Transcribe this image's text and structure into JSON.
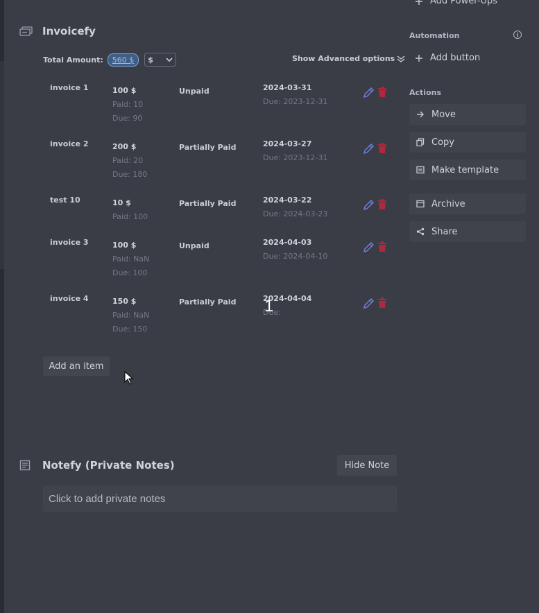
{
  "invoicefy": {
    "title": "Invoicefy",
    "total_label": "Total Amount:",
    "total_value": "560 $",
    "currency": "$",
    "advanced_label": "Show Advanced options",
    "invoices": [
      {
        "name": "invoice 1",
        "amount": "100 $",
        "paid": "Paid: 10",
        "due_amount": "Due: 90",
        "status": "Unpaid",
        "date": "2024-03-31",
        "due_date": "Due: 2023-12-31"
      },
      {
        "name": "invoice 2",
        "amount": "200 $",
        "paid": "Paid: 20",
        "due_amount": "Due: 180",
        "status": "Partially Paid",
        "date": "2024-03-27",
        "due_date": "Due: 2023-12-31"
      },
      {
        "name": "test 10",
        "amount": "10 $",
        "paid": "Paid: 100",
        "due_amount": "",
        "status": "Partially Paid",
        "date": "2024-03-22",
        "due_date": "Due: 2024-03-23"
      },
      {
        "name": "invoice 3",
        "amount": "100 $",
        "paid": "Paid: NaN",
        "due_amount": "Due: 100",
        "status": "Unpaid",
        "date": "2024-04-03",
        "due_date": "Due: 2024-04-10"
      },
      {
        "name": "invoice 4",
        "amount": "150 $",
        "paid": "Paid: NaN",
        "due_amount": "Due: 150",
        "status": "Partially Paid",
        "date": "2024-04-04",
        "due_date": "Due:"
      }
    ],
    "add_item_label": "Add an item"
  },
  "overlay_number": "1",
  "notefy": {
    "title": "Notefy (Private Notes)",
    "hide_label": "Hide Note",
    "placeholder": "Click to add private notes"
  },
  "sidebar": {
    "power_ups_label": "Add Power-Ups",
    "automation_label": "Automation",
    "add_button_label": "Add button",
    "actions_label": "Actions",
    "actions": [
      {
        "label": "Move",
        "icon": "arrow-right-icon"
      },
      {
        "label": "Copy",
        "icon": "copy-icon"
      },
      {
        "label": "Make template",
        "icon": "template-icon"
      },
      {
        "label": "Archive",
        "icon": "archive-icon"
      },
      {
        "label": "Share",
        "icon": "share-icon"
      }
    ]
  },
  "colors": {
    "background": "#3a3c46",
    "badge": "#3f5f86",
    "edit_icon": "#6f7fd8",
    "delete_icon": "#b0283c"
  }
}
